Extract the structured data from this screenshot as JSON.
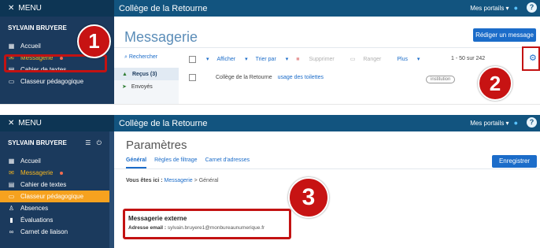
{
  "colors": {
    "topbar_dark": "#0d3554",
    "topbar": "#12547f",
    "sidebar": "#1b3a5d",
    "accent": "#1b6cc9",
    "active_item": "#f6b61f",
    "highlight": "#c31212"
  },
  "menu_label": "MENU",
  "college": "Collège de la Retourne",
  "portals": "Mes portails",
  "help": "?",
  "user": "SYLVAIN BRUYERE",
  "screen1": {
    "sidebar_items": [
      {
        "label": "Accueil",
        "icon": "grid-icon"
      },
      {
        "label": "Messagerie",
        "icon": "mail-icon"
      },
      {
        "label": "Cahier de textes",
        "icon": "notebook-icon"
      },
      {
        "label": "Classeur pédagogique",
        "icon": "folder-icon"
      }
    ],
    "title": "Messagerie",
    "compose_button": "Rédiger un message",
    "search": "Rechercher",
    "toolbar": {
      "display": "Afficher",
      "sort": "Trier par",
      "delete": "Supprimer",
      "file": "Ranger",
      "more": "Plus"
    },
    "range": "1 - 50 sur 242",
    "folders": [
      {
        "label": "Reçus (3)",
        "icon": "inbox-icon"
      },
      {
        "label": "Envoyés",
        "icon": "send-icon"
      }
    ],
    "message": {
      "sender": "Collège de la Retourne",
      "subject": "usage des toilettes",
      "tag": "institution"
    },
    "callouts": [
      "1",
      "2"
    ]
  },
  "screen2": {
    "sidebar_items": [
      {
        "label": "Accueil",
        "icon": "grid-icon"
      },
      {
        "label": "Messagerie",
        "icon": "mail-icon"
      },
      {
        "label": "Cahier de textes",
        "icon": "notebook-icon"
      },
      {
        "label": "Classeur pédagogique",
        "icon": "folder-icon"
      },
      {
        "label": "Absences",
        "icon": "person-icon"
      },
      {
        "label": "Évaluations",
        "icon": "bar-chart-icon"
      },
      {
        "label": "Carnet de liaison",
        "icon": "link-icon"
      }
    ],
    "title": "Paramètres",
    "tabs": [
      "Général",
      "Règles de filtrage",
      "Carnet d'adresses"
    ],
    "save_button": "Enregistrer",
    "breadcrumb_prefix": "Vous êtes ici :",
    "breadcrumb_link": "Messagerie",
    "breadcrumb_sep": ">",
    "breadcrumb_current": "Général",
    "card_title": "Messagerie externe",
    "email_label": "Adresse email :",
    "email_value": "sylvain.bruyere1@monbureaunumerique.fr",
    "callout": "3"
  }
}
